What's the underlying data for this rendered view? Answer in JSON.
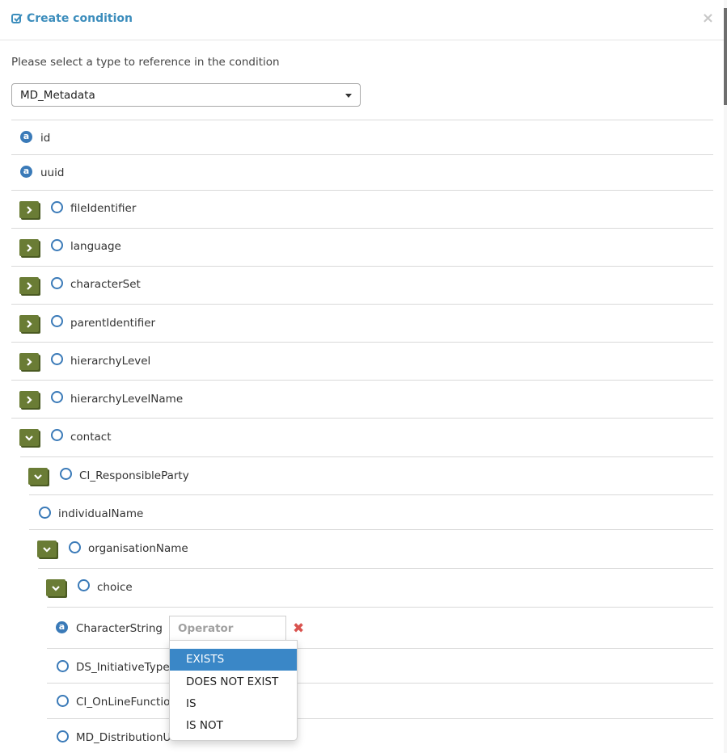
{
  "dialog": {
    "title": "Create condition",
    "close_glyph": "×"
  },
  "prompt": "Please select a type to reference in the condition",
  "type_select": {
    "value": "MD_Metadata"
  },
  "tree": {
    "id": "id",
    "uuid": "uuid",
    "fileIdentifier": "fileIdentifier",
    "language": "language",
    "characterSet": "characterSet",
    "parentIdentifier": "parentIdentifier",
    "hierarchyLevel": "hierarchyLevel",
    "hierarchyLevelName": "hierarchyLevelName",
    "contact": "contact",
    "ci_responsibleparty": "CI_ResponsibleParty",
    "individualName": "individualName",
    "organisationName": "organisationName",
    "choice": "choice",
    "characterString": "CharacterString",
    "ds_initiative": "DS_InitiativeTypeC",
    "ci_online": "CI_OnLineFunction",
    "md_distribution": "MD_DistributionU"
  },
  "operator": {
    "placeholder": "Operator",
    "remove_glyph": "✖",
    "options": [
      "EXISTS",
      "DOES NOT EXIST",
      "IS",
      "IS NOT"
    ],
    "highlighted": "EXISTS"
  },
  "icons": {
    "attribute": "a",
    "accent": "#3a7ab8",
    "toggle_color": "#6a7c35",
    "title_color": "#3c8dbc"
  }
}
